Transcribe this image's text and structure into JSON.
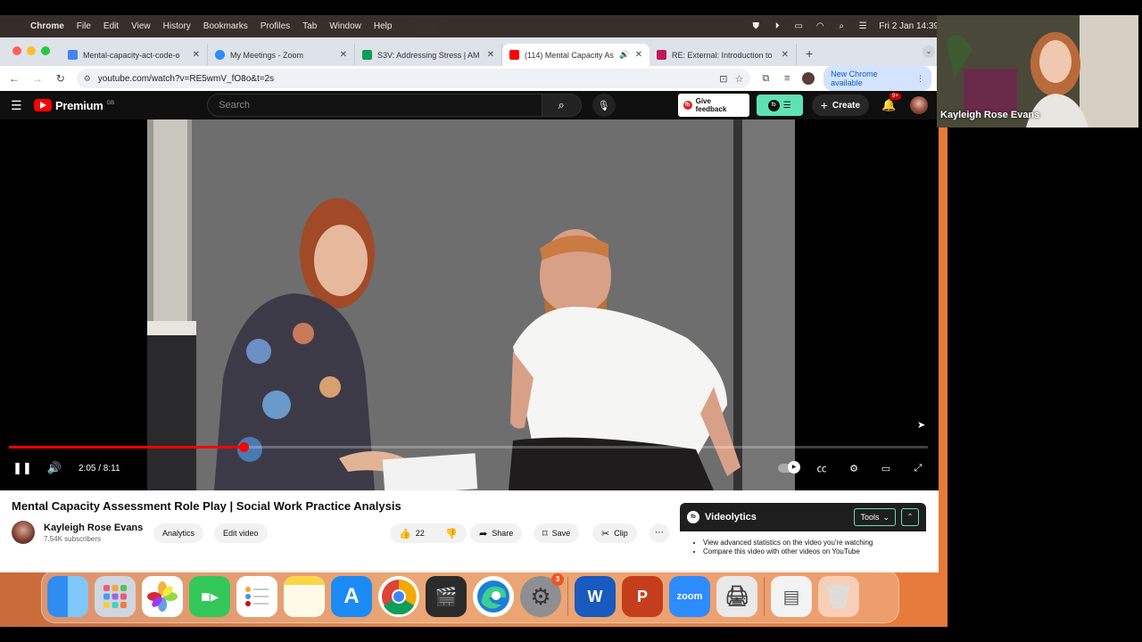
{
  "menubar": {
    "app": "Chrome",
    "menus": [
      "File",
      "Edit",
      "View",
      "History",
      "Bookmarks",
      "Profiles",
      "Tab",
      "Window",
      "Help"
    ],
    "datetime": "Fri 2 Jan  14:39"
  },
  "tabs": [
    {
      "title": "Mental-capacity-act-code-o",
      "favicon_color": "#4285f4"
    },
    {
      "title": "My Meetings - Zoom",
      "favicon_color": "#2d8cff"
    },
    {
      "title": "S3V: Addressing Stress | AM",
      "favicon_color": "#0f9d58"
    },
    {
      "title": "(114) Mental Capacity Ass",
      "favicon_color": "#ff0000"
    },
    {
      "title": "RE: External: Introduction to",
      "favicon_color": "#c2185b"
    }
  ],
  "toolbar": {
    "url": "youtube.com/watch?v=RE5wmV_fO8o&t=2s",
    "new_chrome": "New Chrome available"
  },
  "youtube": {
    "logo": "Premium",
    "region": "GB",
    "search_placeholder": "Search",
    "give_feedback": "Give feedback",
    "create": "Create",
    "notifications": "9+"
  },
  "player": {
    "current_time": "2:05",
    "duration": "8:11",
    "time_display": "2:05 / 8:11",
    "progress_fraction": 0.255
  },
  "video": {
    "title": "Mental Capacity Assessment Role Play | Social Work Practice Analysis",
    "channel": "Kayleigh Rose Evans",
    "subscribers": "7.54K subscribers",
    "analytics": "Analytics",
    "edit_video": "Edit video",
    "likes": "22",
    "share": "Share",
    "save": "Save",
    "clip": "Clip"
  },
  "videolytics": {
    "name": "Videolytics",
    "tools": "Tools",
    "bullets": [
      "View advanced statistics on the video you're watching",
      "Compare this video with other videos on YouTube"
    ]
  },
  "dock": {
    "apps": [
      "Finder",
      "Launchpad",
      "Photos",
      "FaceTime",
      "Reminders",
      "Notes",
      "App Store",
      "Google Chrome",
      "Final Cut Pro",
      "Microsoft Edge",
      "System Settings",
      "Microsoft Word",
      "Microsoft PowerPoint",
      "zoom",
      "Printer",
      "Document",
      "Trash"
    ],
    "settings_badge": "3",
    "zoom_label": "zoom"
  },
  "participant": {
    "name": "Kayleigh Rose Evans"
  }
}
